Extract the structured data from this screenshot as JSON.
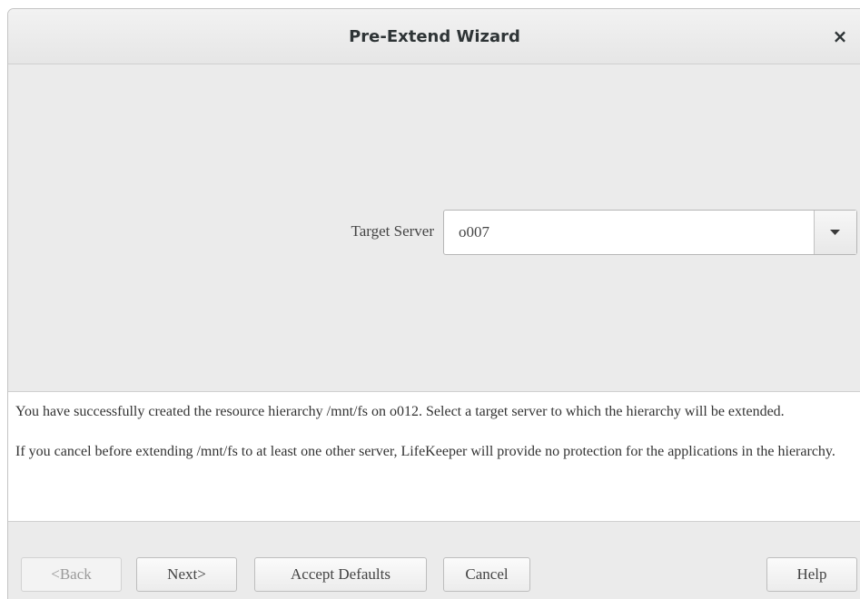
{
  "window": {
    "title": "Pre-Extend Wizard",
    "close_glyph": "×"
  },
  "form": {
    "target_server_label": "Target Server",
    "target_server_value": "o007"
  },
  "message": {
    "paragraph1": "You have successfully created the resource hierarchy /mnt/fs on o012. Select a target server to which the hierarchy will be extended.",
    "paragraph2": "If you cancel before extending /mnt/fs to at least one other server, LifeKeeper will provide no protection for the applications in the hierarchy."
  },
  "buttons": {
    "back": "<Back",
    "next": "Next>",
    "accept_defaults": "Accept Defaults",
    "cancel": "Cancel",
    "help": "Help"
  },
  "icons": {
    "close": "close-icon",
    "dropdown": "caret-down-icon"
  }
}
